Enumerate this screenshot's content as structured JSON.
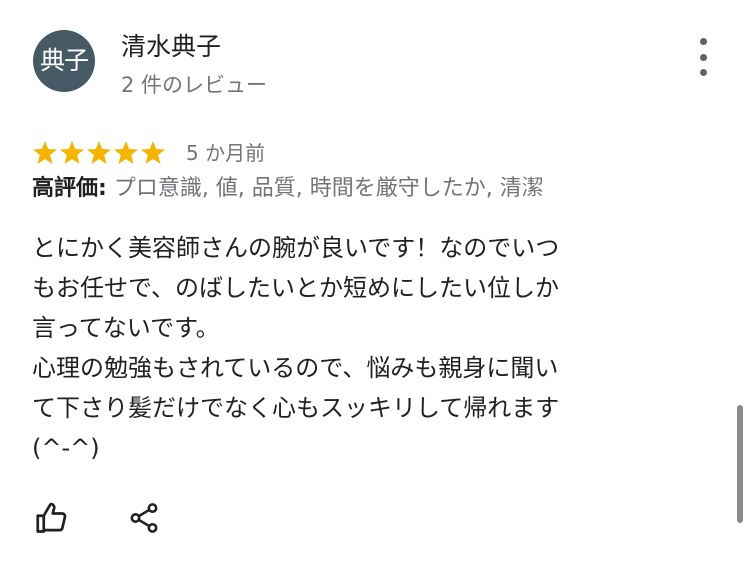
{
  "reviewer": {
    "avatar_text": "典子",
    "name": "清水典子",
    "review_count": "2 件のレビュー"
  },
  "review": {
    "rating": 5,
    "rating_max": 5,
    "time": "5 か月前",
    "highlights_label": "高評価:",
    "highlights": "プロ意識, 値, 品質, 時間を厳守したか, 清潔",
    "text_lines": [
      "とにかく美容師さんの腕が良いです！なのでいつ",
      "もお任せで、のばしたいとか短めにしたい位しか",
      "言ってないです。",
      "心理の勉強もされているので、悩みも親身に聞い",
      "て下さり髪だけでなく心もスッキリして帰れます",
      "(^-^)"
    ]
  },
  "icons": {
    "menu": "more-vert-icon",
    "star": "star-icon",
    "like": "thumb-up-icon",
    "share": "share-icon"
  },
  "colors": {
    "avatar_bg": "#455a64",
    "star": "#f4b400",
    "secondary_text": "#70757a",
    "primary_text": "#202124"
  }
}
